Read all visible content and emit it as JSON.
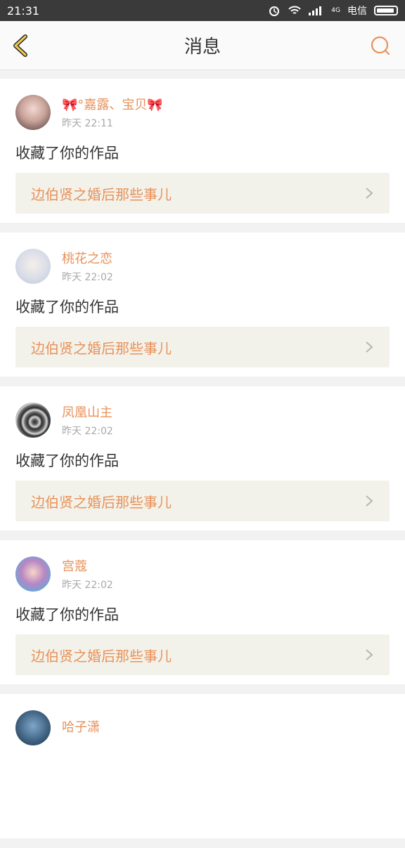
{
  "status": {
    "time": "21:31",
    "network_label": "4G",
    "carrier": "电信"
  },
  "header": {
    "title": "消息"
  },
  "accent_color": "#e8915a",
  "notifications": [
    {
      "username": "🎀°嘉露、宝贝🎀",
      "timestamp": "昨天 22:11",
      "action": "收藏了你的作品",
      "work_title": "边伯贤之婚后那些事儿"
    },
    {
      "username": "桃花之恋",
      "timestamp": "昨天 22:02",
      "action": "收藏了你的作品",
      "work_title": "边伯贤之婚后那些事儿"
    },
    {
      "username": "凤凰山主",
      "timestamp": "昨天 22:02",
      "action": "收藏了你的作品",
      "work_title": "边伯贤之婚后那些事儿"
    },
    {
      "username": "宫蔻",
      "timestamp": "昨天 22:02",
      "action": "收藏了你的作品",
      "work_title": "边伯贤之婚后那些事儿"
    },
    {
      "username": "哈子潇",
      "timestamp": "",
      "action": "",
      "work_title": ""
    }
  ]
}
